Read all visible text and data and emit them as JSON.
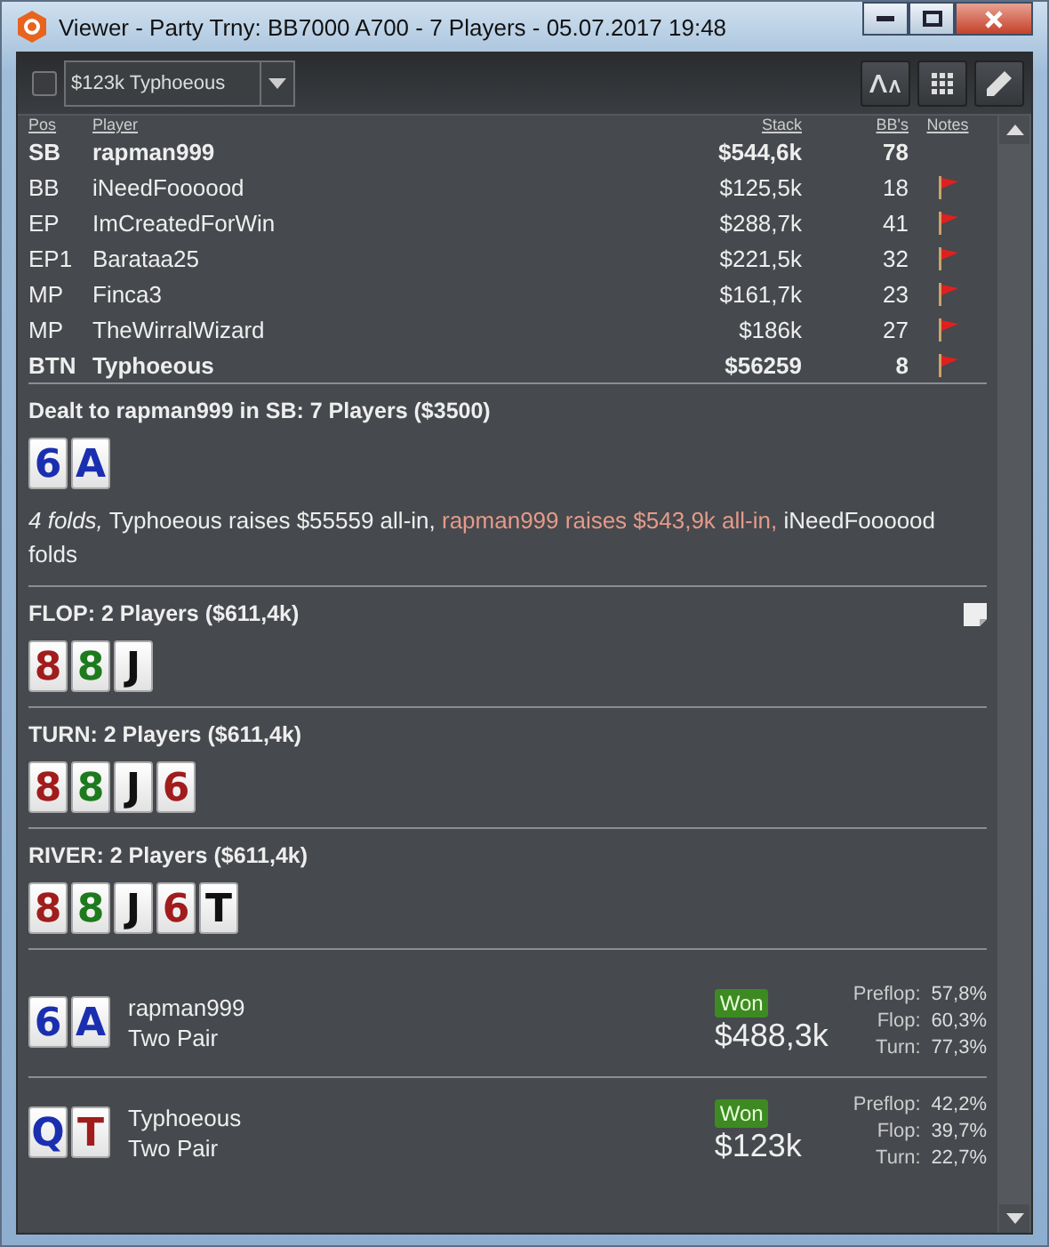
{
  "window": {
    "title": "Viewer - Party Trny: BB7000 A700 - 7 Players - 05.07.2017 19:48"
  },
  "toolbar": {
    "checked": false,
    "dropdown_value": "$123k Typhoeous"
  },
  "players": {
    "columns": [
      "Pos",
      "Player",
      "Stack",
      "BB's",
      "Notes"
    ],
    "rows": [
      {
        "pos": "SB",
        "name": "rapman999",
        "stack": "$544,6k",
        "bb": "78",
        "bold": true,
        "note": false
      },
      {
        "pos": "BB",
        "name": "iNeedFoooood",
        "stack": "$125,5k",
        "bb": "18",
        "bold": false,
        "note": true
      },
      {
        "pos": "EP",
        "name": "ImCreatedForWin",
        "stack": "$288,7k",
        "bb": "41",
        "bold": false,
        "note": true
      },
      {
        "pos": "EP1",
        "name": "Barataa25",
        "stack": "$221,5k",
        "bb": "32",
        "bold": false,
        "note": true
      },
      {
        "pos": "MP",
        "name": "Finca3",
        "stack": "$161,7k",
        "bb": "23",
        "bold": false,
        "note": true
      },
      {
        "pos": "MP",
        "name": "TheWirralWizard",
        "stack": "$186k",
        "bb": "27",
        "bold": false,
        "note": true
      },
      {
        "pos": "BTN",
        "name": "Typhoeous",
        "stack": "$56259",
        "bb": "8",
        "bold": true,
        "note": true
      }
    ]
  },
  "streets": [
    {
      "title": "Dealt to rapman999 in SB: 7 Players ($3500)",
      "note": false,
      "cards": [
        {
          "rank": "6",
          "color": "#1a2fb0"
        },
        {
          "rank": "A",
          "color": "#1a2fb0"
        }
      ],
      "actions": [
        {
          "kind": "folds",
          "text": "4 folds,"
        },
        {
          "kind": "normal",
          "text": "Typhoeous raises $55559 all-in,"
        },
        {
          "kind": "hero",
          "text": "rapman999 raises $543,9k all-in,"
        },
        {
          "kind": "normal",
          "text": "iNeedFoooood folds"
        }
      ]
    },
    {
      "title": "FLOP: 2 Players ($611,4k)",
      "note": true,
      "cards": [
        {
          "rank": "8",
          "color": "#a11c1c"
        },
        {
          "rank": "8",
          "color": "#1d7a1d"
        },
        {
          "rank": "J",
          "color": "#111111"
        }
      ]
    },
    {
      "title": "TURN: 2 Players ($611,4k)",
      "note": false,
      "cards": [
        {
          "rank": "8",
          "color": "#a11c1c"
        },
        {
          "rank": "8",
          "color": "#1d7a1d"
        },
        {
          "rank": "J",
          "color": "#111111"
        },
        {
          "rank": "6",
          "color": "#a11c1c"
        }
      ]
    },
    {
      "title": "RIVER: 2 Players ($611,4k)",
      "note": false,
      "cards": [
        {
          "rank": "8",
          "color": "#a11c1c"
        },
        {
          "rank": "8",
          "color": "#1d7a1d"
        },
        {
          "rank": "J",
          "color": "#111111"
        },
        {
          "rank": "6",
          "color": "#a11c1c"
        },
        {
          "rank": "T",
          "color": "#111111"
        }
      ]
    }
  ],
  "results": [
    {
      "name": "rapman999",
      "hand": "Two Pair",
      "badge": "Won",
      "amount": "$488,3k",
      "cards": [
        {
          "rank": "6",
          "color": "#1a2fb0"
        },
        {
          "rank": "A",
          "color": "#1a2fb0"
        }
      ],
      "equity": [
        {
          "label": "Preflop:",
          "value": "57,8%"
        },
        {
          "label": "Flop:",
          "value": "60,3%"
        },
        {
          "label": "Turn:",
          "value": "77,3%"
        }
      ]
    },
    {
      "name": "Typhoeous",
      "hand": "Two Pair",
      "badge": "Won",
      "amount": "$123k",
      "cards": [
        {
          "rank": "Q",
          "color": "#1a2fb0"
        },
        {
          "rank": "T",
          "color": "#a11c1c"
        }
      ],
      "equity": [
        {
          "label": "Preflop:",
          "value": "42,2%"
        },
        {
          "label": "Flop:",
          "value": "39,7%"
        },
        {
          "label": "Turn:",
          "value": "22,7%"
        }
      ]
    }
  ]
}
